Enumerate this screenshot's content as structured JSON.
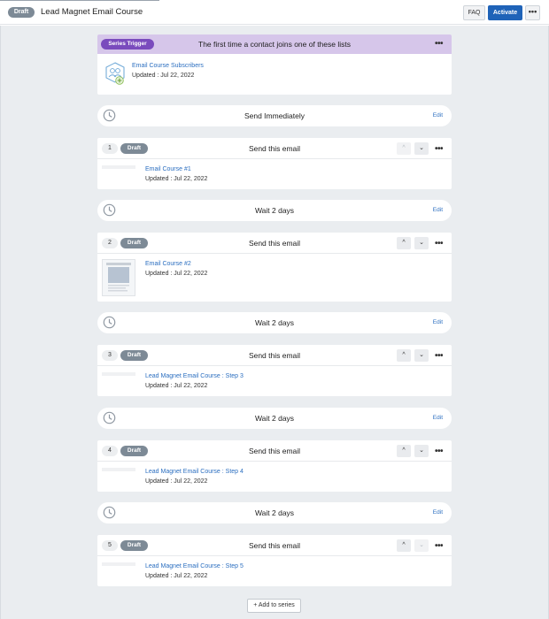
{
  "header": {
    "status": "Draft",
    "title": "Lead Magnet Email Course",
    "faq_label": "FAQ",
    "activate_label": "Activate",
    "menu_label": "•••"
  },
  "trigger": {
    "badge": "Series Trigger",
    "text": "The first time a contact joins one of these lists",
    "menu": "•••",
    "list_name": "Email Course Subscribers",
    "updated": "Updated : Jul 22, 2022"
  },
  "steps": [
    {
      "type": "wait",
      "label": "Send Immediately",
      "edit": "Edit"
    },
    {
      "type": "email",
      "num": "1",
      "status": "Draft",
      "header": "Send this email",
      "up": "^",
      "down": "⌄",
      "menu": "•••",
      "name": "Email Course #1",
      "updated": "Updated : Jul 22, 2022"
    },
    {
      "type": "wait",
      "label": "Wait 2 days",
      "edit": "Edit"
    },
    {
      "type": "email",
      "num": "2",
      "status": "Draft",
      "header": "Send this email",
      "up": "^",
      "down": "⌄",
      "menu": "•••",
      "name": "Email Course #2",
      "updated": "Updated : Jul 22, 2022"
    },
    {
      "type": "wait",
      "label": "Wait 2 days",
      "edit": "Edit"
    },
    {
      "type": "email",
      "num": "3",
      "status": "Draft",
      "header": "Send this email",
      "up": "^",
      "down": "⌄",
      "menu": "•••",
      "name": "Lead Magnet Email Course : Step 3",
      "updated": "Updated : Jul 22, 2022"
    },
    {
      "type": "wait",
      "label": "Wait 2 days",
      "edit": "Edit"
    },
    {
      "type": "email",
      "num": "4",
      "status": "Draft",
      "header": "Send this email",
      "up": "^",
      "down": "⌄",
      "menu": "•••",
      "name": "Lead Magnet Email Course : Step 4",
      "updated": "Updated : Jul 22, 2022"
    },
    {
      "type": "wait",
      "label": "Wait 2 days",
      "edit": "Edit"
    },
    {
      "type": "email",
      "num": "5",
      "status": "Draft",
      "header": "Send this email",
      "up": "^",
      "down": "⌄",
      "menu": "•••",
      "name": "Lead Magnet Email Course : Step 5",
      "updated": "Updated : Jul 22, 2022"
    }
  ],
  "footer": {
    "add_label": "Add to series"
  },
  "colors": {
    "accent": "#1f63b8",
    "trigger_bg": "#d6c6ea",
    "trigger_badge": "#7a4bbd",
    "draft_badge": "#7d8a96",
    "canvas": "#eaedf0"
  }
}
